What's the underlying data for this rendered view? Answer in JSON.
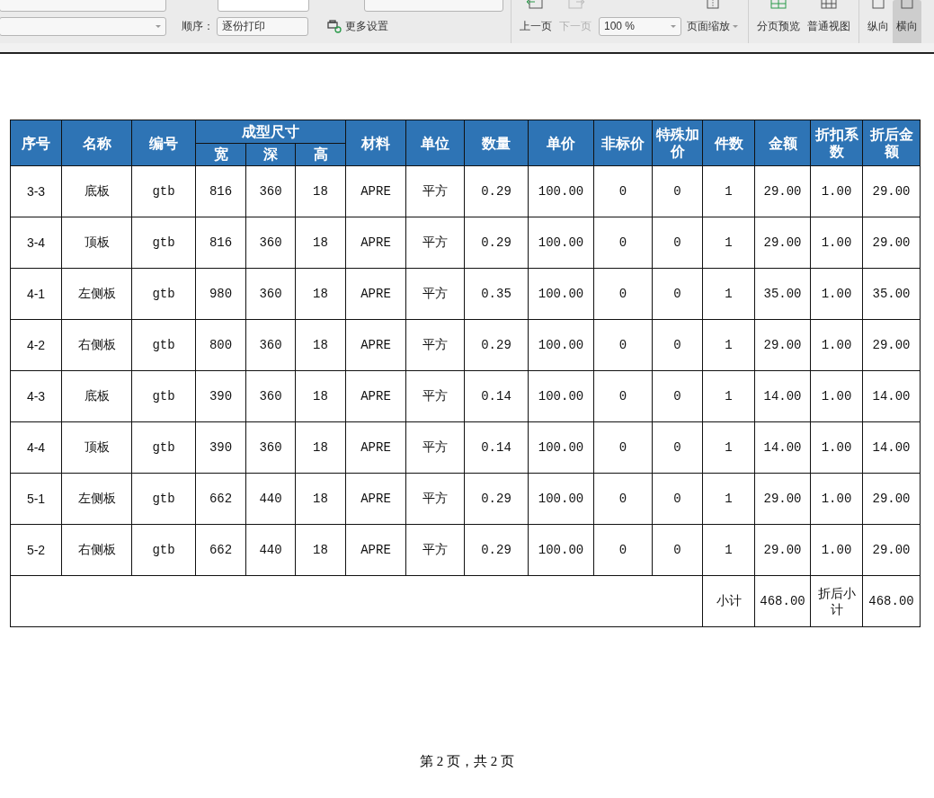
{
  "toolbar": {
    "order_label": "顺序：",
    "order_value": "逐份打印",
    "more_settings": "更多设置",
    "page_buttons": [
      {
        "label": "上一页",
        "kind": "prev",
        "disabled": false
      },
      {
        "label": "下一页",
        "kind": "next",
        "disabled": true
      }
    ],
    "zoom_value": "100 %",
    "page_zoom": "页面缩放",
    "view_buttons": [
      {
        "label": "分页预览",
        "kind": "split"
      },
      {
        "label": "普通视图",
        "kind": "grid"
      }
    ],
    "orientation": [
      {
        "label": "纵向",
        "selected": false
      },
      {
        "label": "横向",
        "selected": true
      }
    ]
  },
  "table": {
    "columns": [
      {
        "label": "序号"
      },
      {
        "label": "名称"
      },
      {
        "label": "编号"
      },
      {
        "label": "成型尺寸",
        "colspan": 3,
        "children": [
          {
            "label": "宽"
          },
          {
            "label": "深"
          },
          {
            "label": "高"
          }
        ]
      },
      {
        "label": "材料"
      },
      {
        "label": "单位"
      },
      {
        "label": "数量"
      },
      {
        "label": "单价"
      },
      {
        "label": "非标价"
      },
      {
        "label": "特殊加价"
      },
      {
        "label": "件数"
      },
      {
        "label": "金额"
      },
      {
        "label": "折扣系数"
      },
      {
        "label": "折后金额"
      }
    ],
    "rows": [
      [
        "3-3",
        "底板",
        "gtb",
        "816",
        "360",
        "18",
        "APRE",
        "平方",
        "0.29",
        "100.00",
        "0",
        "0",
        "1",
        "29.00",
        "1.00",
        "29.00"
      ],
      [
        "3-4",
        "顶板",
        "gtb",
        "816",
        "360",
        "18",
        "APRE",
        "平方",
        "0.29",
        "100.00",
        "0",
        "0",
        "1",
        "29.00",
        "1.00",
        "29.00"
      ],
      [
        "4-1",
        "左侧板",
        "gtb",
        "980",
        "360",
        "18",
        "APRE",
        "平方",
        "0.35",
        "100.00",
        "0",
        "0",
        "1",
        "35.00",
        "1.00",
        "35.00"
      ],
      [
        "4-2",
        "右侧板",
        "gtb",
        "800",
        "360",
        "18",
        "APRE",
        "平方",
        "0.29",
        "100.00",
        "0",
        "0",
        "1",
        "29.00",
        "1.00",
        "29.00"
      ],
      [
        "4-3",
        "底板",
        "gtb",
        "390",
        "360",
        "18",
        "APRE",
        "平方",
        "0.14",
        "100.00",
        "0",
        "0",
        "1",
        "14.00",
        "1.00",
        "14.00"
      ],
      [
        "4-4",
        "顶板",
        "gtb",
        "390",
        "360",
        "18",
        "APRE",
        "平方",
        "0.14",
        "100.00",
        "0",
        "0",
        "1",
        "14.00",
        "1.00",
        "14.00"
      ],
      [
        "5-1",
        "左侧板",
        "gtb",
        "662",
        "440",
        "18",
        "APRE",
        "平方",
        "0.29",
        "100.00",
        "0",
        "0",
        "1",
        "29.00",
        "1.00",
        "29.00"
      ],
      [
        "5-2",
        "右侧板",
        "gtb",
        "662",
        "440",
        "18",
        "APRE",
        "平方",
        "0.29",
        "100.00",
        "0",
        "0",
        "1",
        "29.00",
        "1.00",
        "29.00"
      ]
    ],
    "subtotal": {
      "label": "小计",
      "amount": "468.00",
      "discount_label": "折后小计",
      "discounted": "468.00"
    }
  },
  "footer": "第 2 页，共 2 页"
}
